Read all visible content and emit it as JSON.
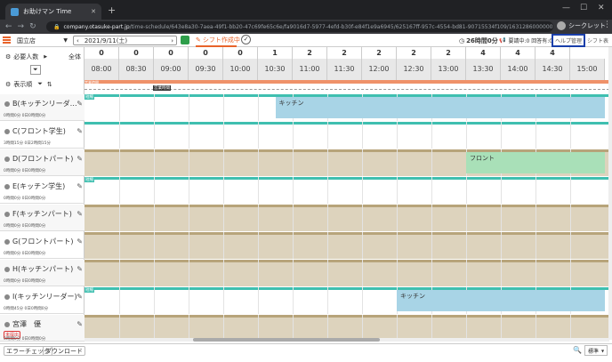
{
  "browser": {
    "tab_title": "お助けマン Time",
    "url_domain": "company.otasuke-part.jp",
    "url_path": "/time-schedule/643e8a30-7aea-49f1-bb20-47c69fe65c6e/fa9016d7-5977-4efd-b30f-e84f1e9a6945/625167ff-957c-4554-bd81-90715534f109/1631286000000",
    "profile_label": "シークレット"
  },
  "toolbar": {
    "store": "国立店",
    "date": "2021/9/11(土)",
    "shift_button": "シフト作成中",
    "hours": "26時間0分",
    "counts": "要請中:0 回答有:0",
    "help": "ヘルプ管理",
    "shift_list": "シフト表"
  },
  "left_panel": {
    "required_people": "必要人数",
    "all_label": "全体",
    "display_order": "表示順"
  },
  "timeline": {
    "counts": [
      "0",
      "0",
      "0",
      "0",
      "0",
      "1",
      "2",
      "2",
      "2",
      "2",
      "2",
      "4",
      "4",
      "4"
    ],
    "times": [
      "08:00",
      "08:30",
      "09:00",
      "09:30",
      "10:00",
      "10:30",
      "11:00",
      "11:30",
      "12:00",
      "12:30",
      "13:00",
      "13:30",
      "14:00",
      "14:30",
      "15:00"
    ],
    "business_label": "営業時間",
    "opening_label": "営業時間"
  },
  "employees": [
    {
      "name": "B(キッチンリーダ…",
      "sub": "0時間0分 0日0時間0分",
      "tag": "短縮",
      "shift": {
        "label": "キッチン",
        "start": "10:45",
        "end": "15:30",
        "color": "#a8d4e6"
      }
    },
    {
      "name": "C(フロント学生)",
      "sub": "3時間15分 0日2時間15分",
      "tag": "",
      "shift": {
        "label": "",
        "start": "08:00",
        "end": "15:30",
        "color": "#ffffff"
      }
    },
    {
      "name": "D(フロントパート)",
      "sub": "0時間0分 0日0時間0分",
      "tag": "",
      "shift": {
        "label": "フロント",
        "start": "13:30",
        "end": "15:30",
        "color": "#a9e0b8"
      }
    },
    {
      "name": "E(キッチン学生)",
      "sub": "0時間0分 0日0時間0分",
      "tag": "短縮",
      "shift": null
    },
    {
      "name": "F(キッチンパート)",
      "sub": "0時間0分 0日0時間0分",
      "tag": "",
      "shift": null
    },
    {
      "name": "G(フロントパート)",
      "sub": "0時間0分 0日0時間0分",
      "tag": "",
      "shift": null
    },
    {
      "name": "H(キッチンパート)",
      "sub": "0時間0分 0日0時間0分",
      "tag": "",
      "shift": null
    },
    {
      "name": "I(キッチンリーダー)",
      "sub": "0時間45分 0日0時間0分",
      "tag": "短縮",
      "shift": {
        "label": "キッチン",
        "start": "12:30",
        "end": "15:30",
        "color": "#a8d4e6"
      }
    },
    {
      "name": "宮澤　優",
      "sub": "0時間0分 0日0時間0分",
      "badge": "未提出",
      "tag": "",
      "shift": null
    }
  ],
  "footer": {
    "error_check": "エラーチェック",
    "download": "ダウンロード",
    "zoom": "標準"
  },
  "colors": {
    "accent": "#e8632a",
    "help_border": "#1a3faa",
    "unavailable": "#ddd3bd",
    "top_bar": "#3fbfb0"
  }
}
